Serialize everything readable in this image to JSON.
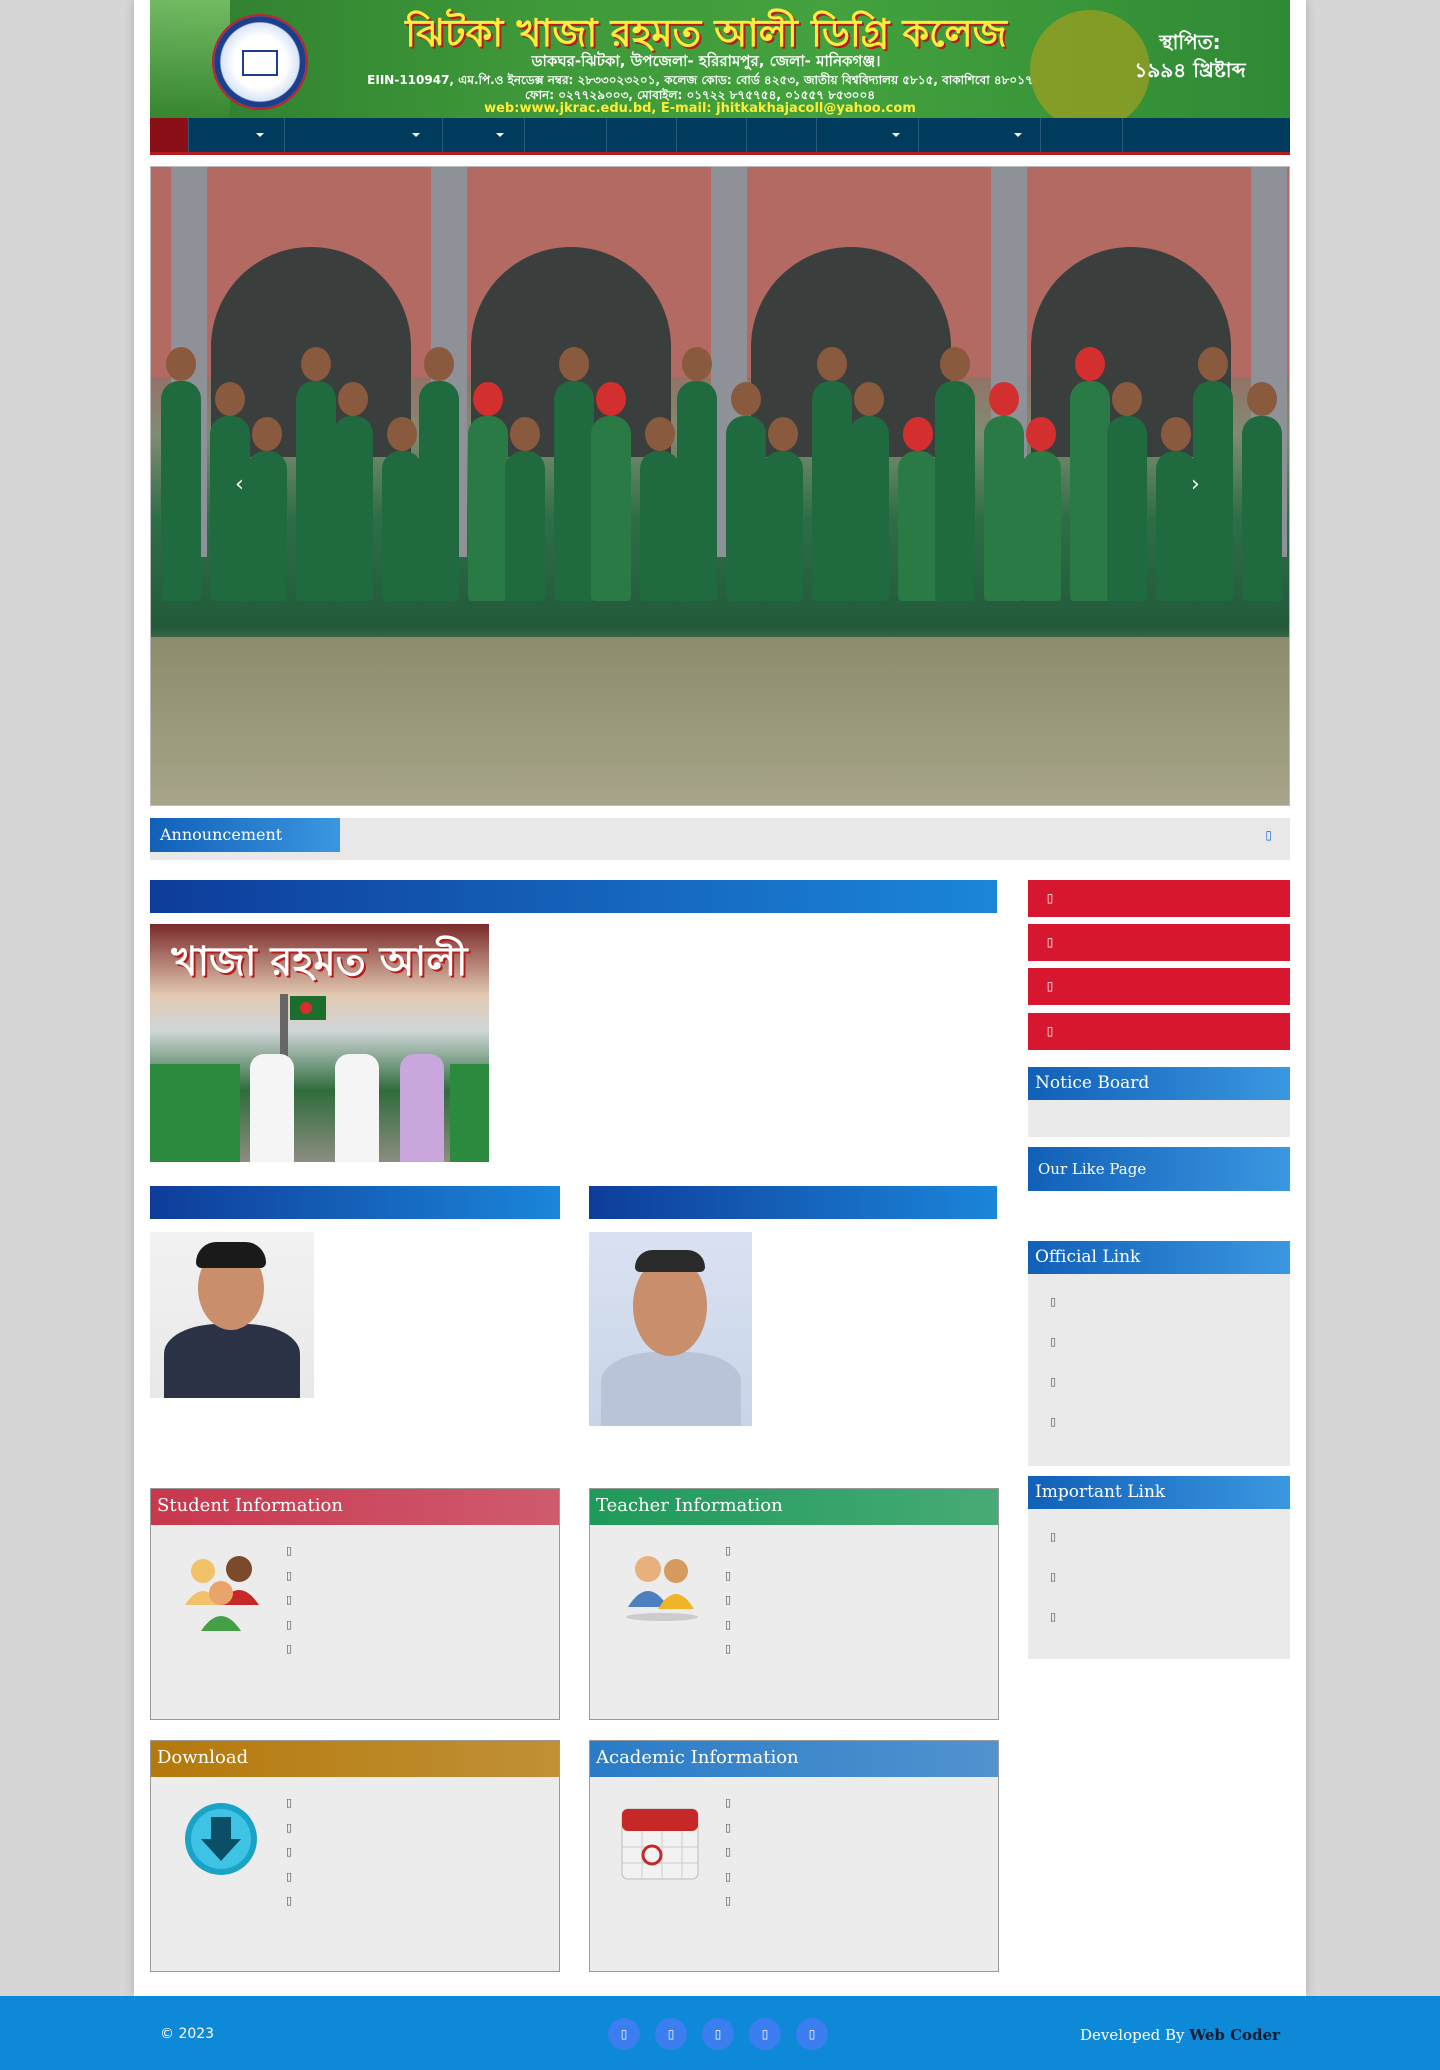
{
  "header": {
    "college_name": "ঝিটকা খাজা রহমত আলী ডিগ্রি কলেজ",
    "address": "ডাকঘর-ঝিটকা, উপজেলা- হরিরামপুর, জেলা- মানিকগঞ্জ।",
    "eiin": "EIIN-110947, এম.পি.ও ইনডেক্স নম্বর: ২৮৩৩০২৩২০১, কলেজ কোড: বোর্ড ৪২৫৩, জাতীয় বিশ্ববিদ্যালয় ৫৮১৫, বাকাশিবো ৪৮০১৭",
    "phone": "ফোন: ০২৭৭২৯০০৩, মোবাইল: ০১৭২২ ৮৭৫৭৫৪, ০১৫৫৭ ৮৫৩০০৪",
    "web": "web:www.jkrac.edu.bd, E-mail: jhitkakhajacoll@yahoo.com",
    "established_label": "স্থাপিত:",
    "established_year": "১৯৯৪ খ্রিষ্টাব্দ"
  },
  "nav": {
    "items": [
      {
        "label": "",
        "active": true,
        "dropdown": false
      },
      {
        "label": "",
        "dropdown": true
      },
      {
        "label": "",
        "dropdown": true
      },
      {
        "label": "",
        "dropdown": true
      },
      {
        "label": "",
        "dropdown": false
      },
      {
        "label": "",
        "dropdown": false
      },
      {
        "label": "",
        "dropdown": false
      },
      {
        "label": "",
        "dropdown": false
      },
      {
        "label": "",
        "dropdown": true
      },
      {
        "label": "",
        "dropdown": true
      },
      {
        "label": "",
        "dropdown": false
      },
      {
        "label": "",
        "dropdown": false
      }
    ]
  },
  "slider": {
    "prev_icon": "‹",
    "next_icon": "›"
  },
  "announcement": {
    "label": "Announcement",
    "text": ""
  },
  "history": {
    "heading": "",
    "text": "",
    "more": ""
  },
  "principal": {
    "heading": "",
    "text": "",
    "more": ""
  },
  "founder": {
    "heading": "",
    "text": "",
    "more": ""
  },
  "sidebar": {
    "buttons": [
      "",
      "",
      "",
      ""
    ],
    "notice_board": "Notice Board",
    "like_page": "Our Like Page",
    "official_link": {
      "title": "Official Link",
      "items": [
        "",
        "",
        "",
        ""
      ]
    },
    "important_link": {
      "title": "Important Link",
      "items": [
        "",
        "",
        ""
      ]
    }
  },
  "panels": {
    "student": {
      "title": "Student Information",
      "color": "#c8374e",
      "items": [
        "",
        "",
        "",
        "",
        ""
      ]
    },
    "teacher": {
      "title": "Teacher Information",
      "color": "#1e9a5a",
      "items": [
        "",
        "",
        "",
        "",
        ""
      ]
    },
    "download": {
      "title": "Download",
      "color": "#b5790a",
      "items": [
        "",
        "",
        "",
        "",
        ""
      ]
    },
    "academic": {
      "title": "Academic Information",
      "color": "#2a7cc7",
      "items": [
        "",
        "",
        "",
        "",
        ""
      ]
    }
  },
  "footer": {
    "copyright": "© 2023",
    "developed_by": "Developed By",
    "developer": "Web Coder",
    "social": [
      "",
      "",
      "",
      "",
      ""
    ]
  },
  "colors": {
    "nav_bg": "#003a5c",
    "nav_active": "#8b0f17",
    "side_button": "#d7162f",
    "footer_bg": "#0e89d8",
    "heading_blue": "#1160b8"
  }
}
